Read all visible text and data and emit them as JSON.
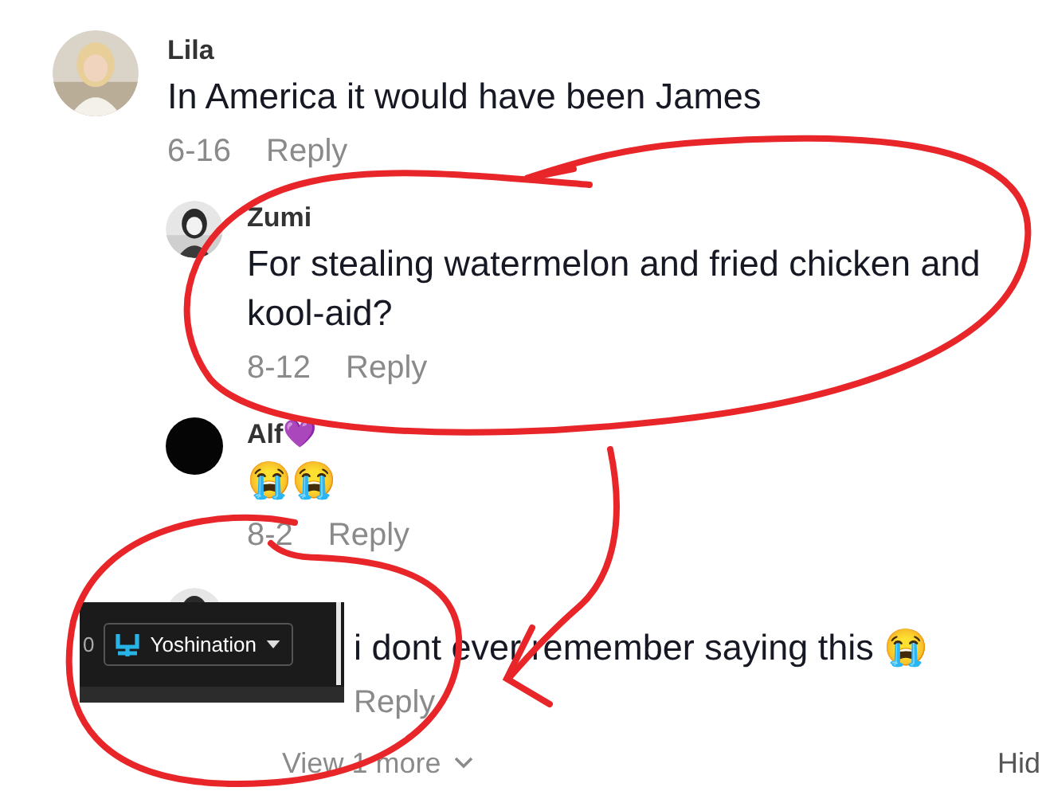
{
  "comments": [
    {
      "kind": "top",
      "author": "Lila",
      "text": "In America it would have been James",
      "date": "6-16",
      "reply": "Reply"
    },
    {
      "kind": "reply",
      "author": "Zumi",
      "text": "For stealing watermelon and fried chicken and kool-aid?",
      "date": "8-12",
      "reply": "Reply"
    },
    {
      "kind": "reply",
      "avatar": {
        "kind": "plain"
      },
      "author": "Alf💜",
      "text": "😭😭",
      "date": "8-2",
      "reply": "Reply"
    },
    {
      "kind": "covered",
      "text": "i dont ever remember saying this 😭",
      "reply": "Reply"
    }
  ],
  "more": {
    "label": "View 1 more",
    "hide": "Hid"
  },
  "overlay": {
    "count": "0",
    "account": "Yoshination"
  }
}
